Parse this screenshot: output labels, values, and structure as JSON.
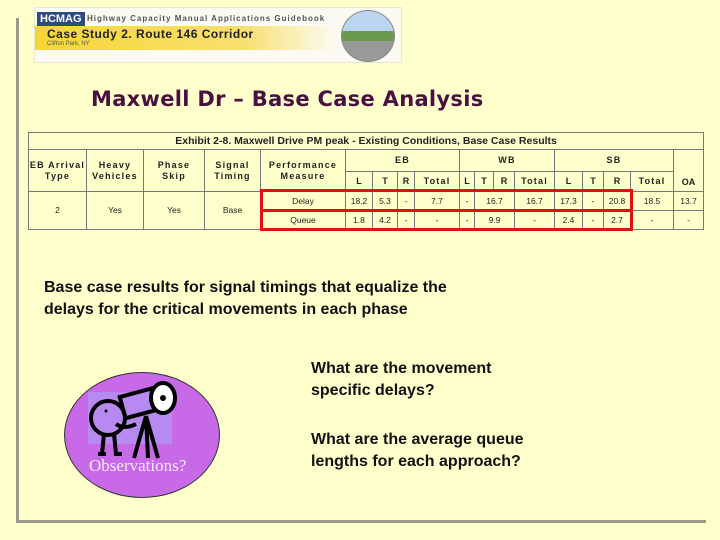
{
  "banner": {
    "logo": "HCMAG",
    "guide": "Highway Capacity Manual Applications Guidebook",
    "case_study": "Case Study 2. Route 146 Corridor",
    "location": "Clifton Park, NY"
  },
  "title": "Maxwell Dr – Base Case Analysis",
  "table": {
    "caption": "Exhibit 2-8. Maxwell Drive PM peak - Existing Conditions, Base Case Results",
    "headers": {
      "arrival": "EB Arrival Type",
      "heavy": "Heavy Vehicles",
      "phase": "Phase Skip",
      "signal": "Signal Timing",
      "perf": "Performance Measure",
      "eb": "EB",
      "wb": "WB",
      "sb": "SB",
      "oa": "OA",
      "l": "L",
      "t": "T",
      "r": "R",
      "total": "Total"
    },
    "row": {
      "arrival": "2",
      "heavy": "Yes",
      "phase": "Yes",
      "signal": "Base"
    },
    "delay": {
      "label": "Delay",
      "eb_l": "18.2",
      "eb_t": "5.3",
      "eb_r": "-",
      "eb_total": "7.7",
      "wb_l": "-",
      "wb_tr": "16.7",
      "wb_total": "16.7",
      "sb_l": "17.3",
      "sb_t": "-",
      "sb_r": "20.8",
      "sb_total": "18.5",
      "oa": "13.7"
    },
    "queue": {
      "label": "Queue",
      "eb_l": "1.8",
      "eb_t": "4.2",
      "eb_r": "-",
      "eb_total": "-",
      "wb_l": "-",
      "wb_tr": "9.9",
      "wb_total": "-",
      "sb_l": "2.4",
      "sb_t": "-",
      "sb_r": "2.7",
      "sb_total": "-",
      "oa": "-"
    }
  },
  "text": {
    "summary": "Base case results for signal timings that equalize the delays for the critical movements in each phase",
    "q1": "What are the movement specific delays?",
    "q2": "What are the average queue lengths for each approach?",
    "observations": "Observations?"
  },
  "colors": {
    "background": "#ffffcc",
    "highlight": "#e01010",
    "title": "#4a1040",
    "bubble": "#c86ae8"
  }
}
